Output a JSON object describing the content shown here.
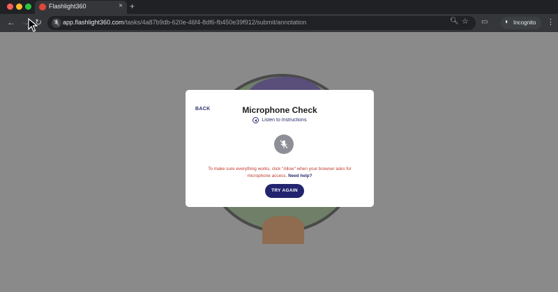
{
  "browser": {
    "tab": {
      "title": "Flashlight360",
      "close": "×"
    },
    "new_tab": "+",
    "nav": {
      "back": "←",
      "forward": "→",
      "reload": "↻"
    },
    "url": {
      "host": "app.flashlight360.com",
      "path": "/tasks/4a87b9db-620e-46f4-8df6-fb450e39f912/submit/annotation"
    },
    "zoom_icon": "zoom-icon",
    "star_icon": "bookmark-star-icon",
    "incognito_label": "Incognito",
    "menu": "⋮"
  },
  "modal": {
    "back_label": "BACK",
    "title": "Microphone Check",
    "listen_label": "Listen to Instructions",
    "message": "To make sure everything works, click \"Allow\" when your browser asks for microphone access.",
    "help_label": "Need help?",
    "try_again_label": "TRY AGAIN"
  },
  "colors": {
    "accent": "#23246f",
    "error_text": "#c0392b",
    "overlay": "#8a8a8a",
    "mic_disabled": "#8e8f96"
  }
}
